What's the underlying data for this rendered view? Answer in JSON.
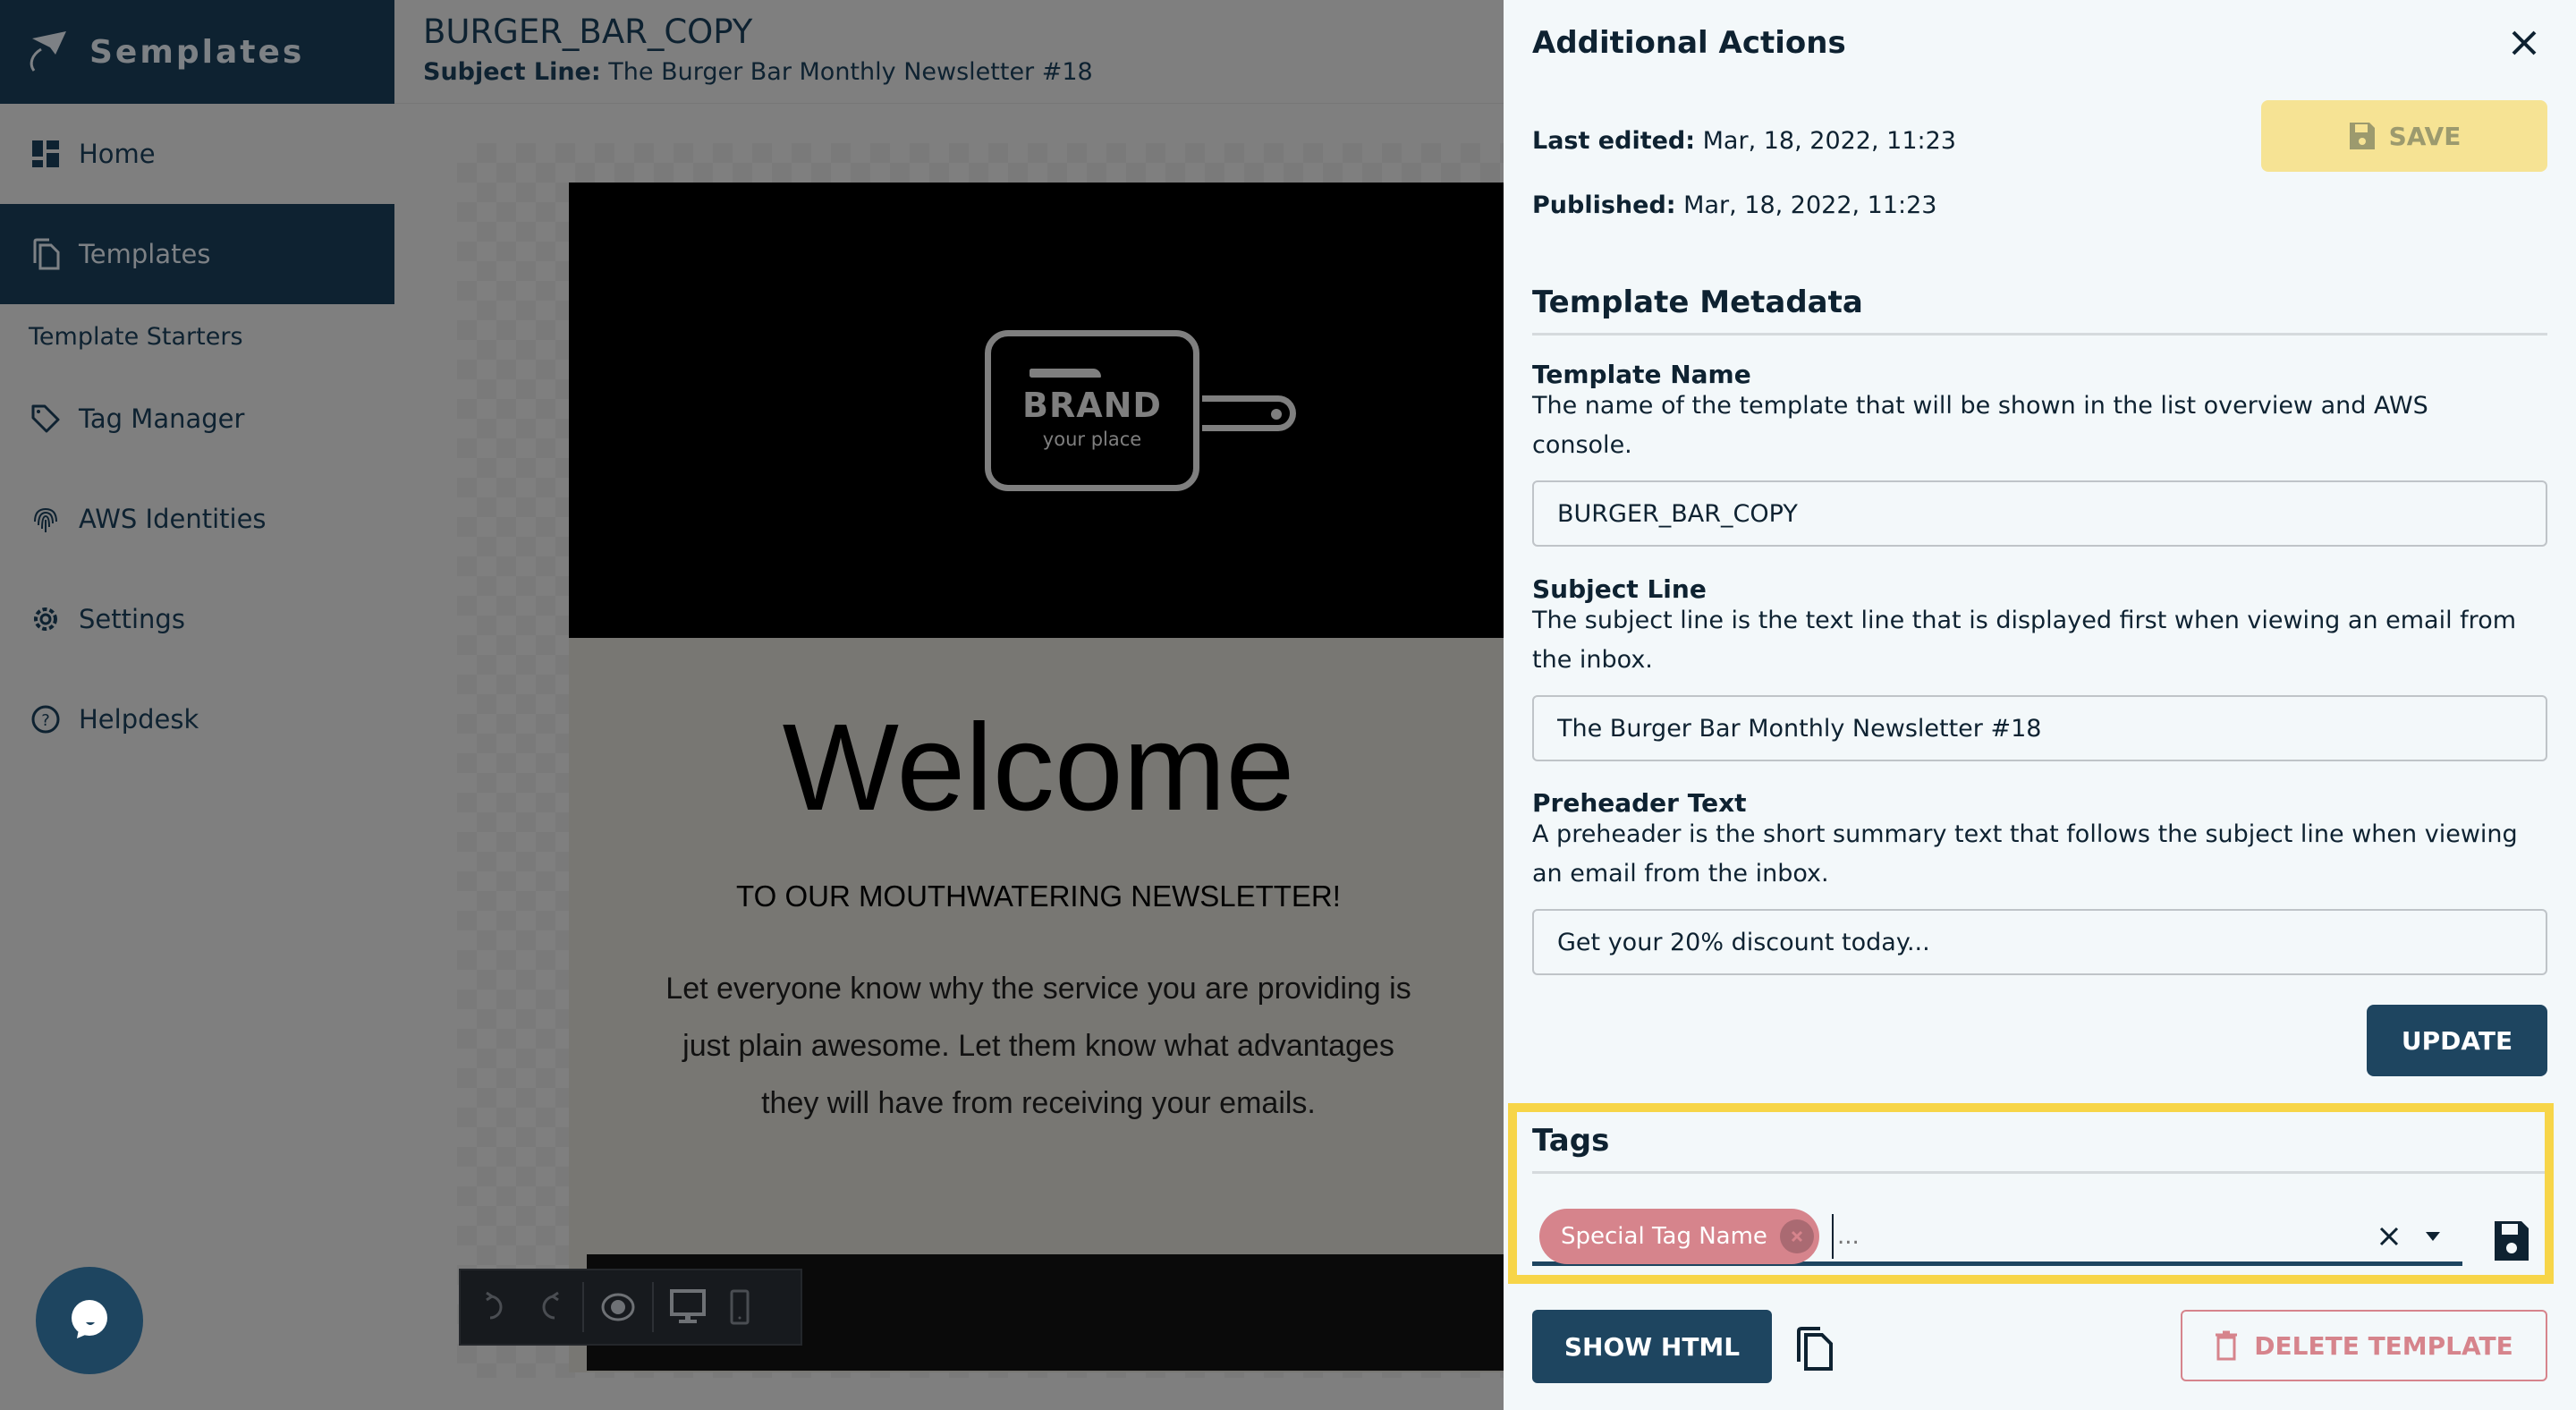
{
  "app": {
    "brand_name": "Semplates"
  },
  "sidebar": {
    "items": [
      {
        "label": "Home",
        "icon": "dashboard-icon"
      },
      {
        "label": "Templates",
        "icon": "copy-icon",
        "active": true
      },
      {
        "label": "Template Starters",
        "sub": true
      },
      {
        "label": "Tag Manager",
        "icon": "tag-icon"
      },
      {
        "label": "AWS Identities",
        "icon": "fingerprint-icon"
      },
      {
        "label": "Settings",
        "icon": "gear-icon"
      },
      {
        "label": "Helpdesk",
        "icon": "help-circle-icon"
      }
    ]
  },
  "main": {
    "title": "BURGER_BAR_COPY",
    "subject_label": "Subject Line:",
    "subject_value": "The Burger Bar Monthly Newsletter #18",
    "email": {
      "logo_brand": "BRAND",
      "logo_tagline": "your place",
      "welcome": "Welcome",
      "tagline": "TO OUR MOUTHWATERING NEWSLETTER!",
      "body": "Let everyone know why the service you are providing is just plain awesome. Let them know what advantages they will have from receiving your emails."
    },
    "toolbar": [
      "undo-icon",
      "redo-icon",
      "eye-icon",
      "desktop-icon",
      "mobile-icon"
    ]
  },
  "panel": {
    "title": "Additional Actions",
    "last_edited_label": "Last edited:",
    "last_edited_value": "Mar, 18, 2022, 11:23",
    "published_label": "Published:",
    "published_value": "Mar, 18, 2022, 11:23",
    "save_label": "SAVE",
    "metadata_heading": "Template Metadata",
    "fields": {
      "name": {
        "label": "Template Name",
        "description": "The name of the template that will be shown in the list overview and AWS console.",
        "value": "BURGER_BAR_COPY"
      },
      "subject": {
        "label": "Subject Line",
        "description": "The subject line is the text line that is displayed first when viewing an email from the inbox.",
        "value": "The Burger Bar Monthly Newsletter #18"
      },
      "preheader": {
        "label": "Preheader Text",
        "description": "A preheader is the short summary text that follows the subject line when viewing an email from the inbox.",
        "value": "Get your 20% discount today..."
      }
    },
    "update_label": "UPDATE",
    "tags": {
      "heading": "Tags",
      "chips": [
        "Special Tag Name"
      ],
      "input_placeholder": "..."
    },
    "show_html_label": "SHOW HTML",
    "delete_label": "DELETE TEMPLATE"
  },
  "colors": {
    "navy": "#0e2231",
    "primary": "#1e4560",
    "save_yellow": "#f6e394",
    "highlight": "#f7d548",
    "danger": "#d6848c"
  }
}
